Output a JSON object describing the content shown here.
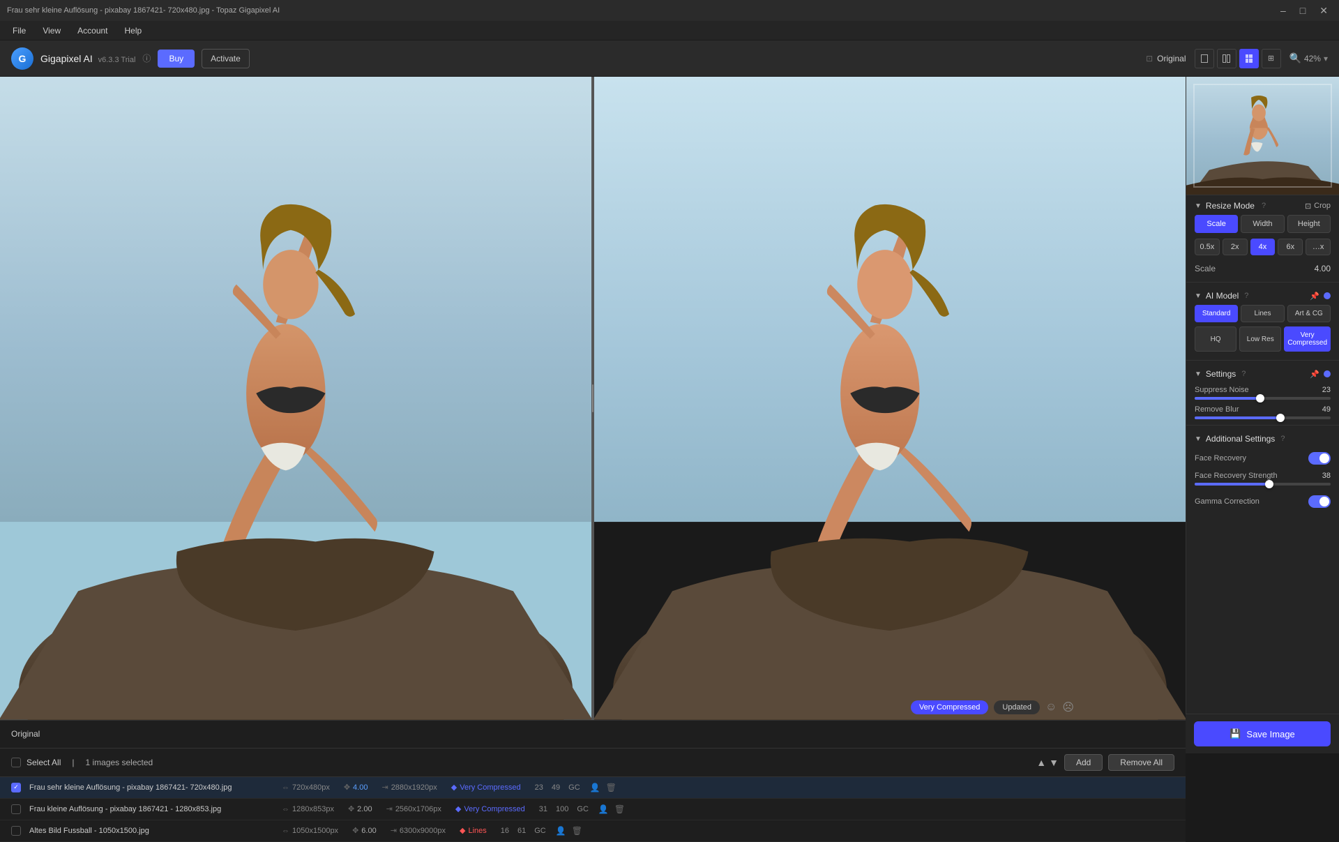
{
  "titleBar": {
    "title": "Frau sehr kleine Auflösung - pixabay 1867421- 720x480.jpg - Topaz Gigapixel AI",
    "closeBtn": "✕",
    "minBtn": "–",
    "maxBtn": "□"
  },
  "menuBar": {
    "items": [
      "File",
      "View",
      "Account",
      "Help"
    ]
  },
  "header": {
    "logoText": "G",
    "appName": "Gigapixel AI",
    "version": "v6.3.3 Trial",
    "infoIcon": "ⓘ",
    "buyBtn": "Buy",
    "activateBtn": "Activate",
    "originalLabel": "Original",
    "zoomLevel": "42%"
  },
  "viewControls": {
    "single": "□",
    "splitV": "⊟",
    "splitH": "⊞",
    "quad": "⊠"
  },
  "canvas": {
    "originalLabel": "Original",
    "splitPosition": 50
  },
  "bottomBadge": {
    "modelBadge": "Very Compressed",
    "updatedBadge": "Updated"
  },
  "rightPanel": {
    "resizeMode": "Resize Mode",
    "resizeModeHelp": "?",
    "cropBtn": "Crop",
    "scaleOptions": [
      "Scale",
      "Width",
      "Height"
    ],
    "activeScale": "Scale",
    "multipliers": [
      "0.5x",
      "2x",
      "4x",
      "6x",
      "…x"
    ],
    "activeMultiplier": "4x",
    "scaleLabel": "Scale",
    "scaleValue": "4.00",
    "aiModel": {
      "title": "AI Model",
      "help": "?",
      "models": [
        "Standard",
        "Lines",
        "Art & CG"
      ],
      "activeModel": "Standard",
      "qualities": [
        "HQ",
        "Low Res",
        "Very Compressed"
      ],
      "activeQuality": "Very Compressed"
    },
    "settings": {
      "title": "Settings",
      "help": "?",
      "suppressNoise": {
        "label": "Suppress Noise",
        "value": 23,
        "fillPercent": 48
      },
      "removeBlur": {
        "label": "Remove Blur",
        "value": 49,
        "fillPercent": 63
      }
    },
    "additionalSettings": {
      "title": "Additional Settings",
      "help": "?",
      "faceRecovery": {
        "label": "Face Recovery",
        "enabled": true
      },
      "faceRecoveryStrength": {
        "label": "Face Recovery Strength",
        "value": 38,
        "fillPercent": 55
      },
      "gammaCorrection": {
        "label": "Gamma Correction",
        "enabled": true
      }
    },
    "saveBtn": "Save Image"
  },
  "fileList": {
    "selectAll": "Select All",
    "selectedCount": "1 images selected",
    "addBtn": "Add",
    "removeAllBtn": "Remove All",
    "files": [
      {
        "id": 1,
        "name": "Frau sehr kleine Auflösung - pixabay 1867421- 720x480.jpg",
        "checked": true,
        "sizeIn": "720x480px",
        "scale": "4.00",
        "sizeOut": "2880x1920px",
        "model": "Very Compressed",
        "modelColor": "blue",
        "noise": 23,
        "blur": 49,
        "gc": "GC",
        "selected": true
      },
      {
        "id": 2,
        "name": "Frau kleine Auflösung - pixabay 1867421 - 1280x853.jpg",
        "checked": false,
        "sizeIn": "1280x853px",
        "scale": "2.00",
        "sizeOut": "2560x1706px",
        "model": "Very Compressed",
        "modelColor": "blue",
        "noise": 31,
        "blur": 100,
        "gc": "GC",
        "selected": false
      },
      {
        "id": 3,
        "name": "Altes Bild Fussball - 1050x1500.jpg",
        "checked": false,
        "sizeIn": "1050x1500px",
        "scale": "6.00",
        "sizeOut": "6300x9000px",
        "model": "Lines",
        "modelColor": "red",
        "noise": 16,
        "blur": 61,
        "gc": "GC",
        "selected": false
      }
    ]
  }
}
